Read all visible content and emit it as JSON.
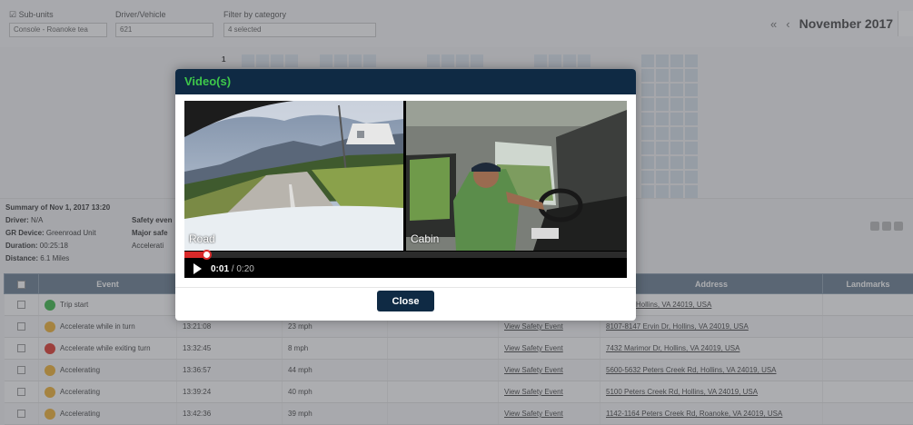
{
  "filters": {
    "subunits_label": "Sub-units",
    "subunits_value": "Console - Roanoke tea",
    "driver_label": "Driver/Vehicle",
    "driver_value": "621",
    "category_label": "Filter by category",
    "category_value": "4 selected"
  },
  "calendar": {
    "month": "November 2017",
    "prev_icon": "double-chevron-left-icon",
    "day_marker": "1"
  },
  "summary": {
    "title": "Summary of Nov 1, 2017 13:20",
    "driver_key": "Driver:",
    "driver_val": "N/A",
    "gr_device_key": "GR Device:",
    "gr_device_val": "Greenroad Unit",
    "duration_key": "Duration:",
    "duration_val": "00:25:18",
    "distance_key": "Distance:",
    "distance_val": "6.1 Miles",
    "safety_events_key": "Safety even",
    "major_safety_key": "Major safe",
    "acceleration_key": "Accelerati"
  },
  "table": {
    "headers": [
      "",
      "Event",
      "",
      "",
      "",
      "",
      "Address",
      "Landmarks"
    ],
    "rows": [
      {
        "event": "Trip start",
        "color": "#3dbb4a",
        "time": "",
        "speed": "",
        "link": "",
        "address": "Ervin Dr, Hollins, VA 24019, USA"
      },
      {
        "event": "Accelerate while in turn",
        "color": "#f2b233",
        "time": "13:21:08",
        "speed": "23 mph",
        "link": "View Safety Event",
        "address": "8107-8147 Ervin Dr, Hollins, VA 24019, USA"
      },
      {
        "event": "Accelerate while exiting turn",
        "color": "#e23a2e",
        "time": "13:32:45",
        "speed": "8 mph",
        "link": "View Safety Event",
        "address": "7432 Marimor Dr, Hollins, VA 24019, USA"
      },
      {
        "event": "Accelerating",
        "color": "#f2b233",
        "time": "13:36:57",
        "speed": "44 mph",
        "link": "View Safety Event",
        "address": "5600-5632 Peters Creek Rd, Hollins, VA 24019, USA"
      },
      {
        "event": "Accelerating",
        "color": "#f2b233",
        "time": "13:39:24",
        "speed": "40 mph",
        "link": "View Safety Event",
        "address": "5100 Peters Creek Rd, Hollins, VA 24019, USA"
      },
      {
        "event": "Accelerating",
        "color": "#f2b233",
        "time": "13:42:36",
        "speed": "39 mph",
        "link": "View Safety Event",
        "address": "1142-1164 Peters Creek Rd, Roanoke, VA 24019, USA"
      }
    ]
  },
  "modal": {
    "title": "Video(s)",
    "road_label": "Road",
    "cabin_label": "Cabin",
    "current_time": "0:01",
    "duration": "/ 0:20",
    "progress": 0.05,
    "close_label": "Close",
    "accent_color": "#3ec84a",
    "header_color": "#0f2a44",
    "progress_color": "#d92a2a"
  }
}
